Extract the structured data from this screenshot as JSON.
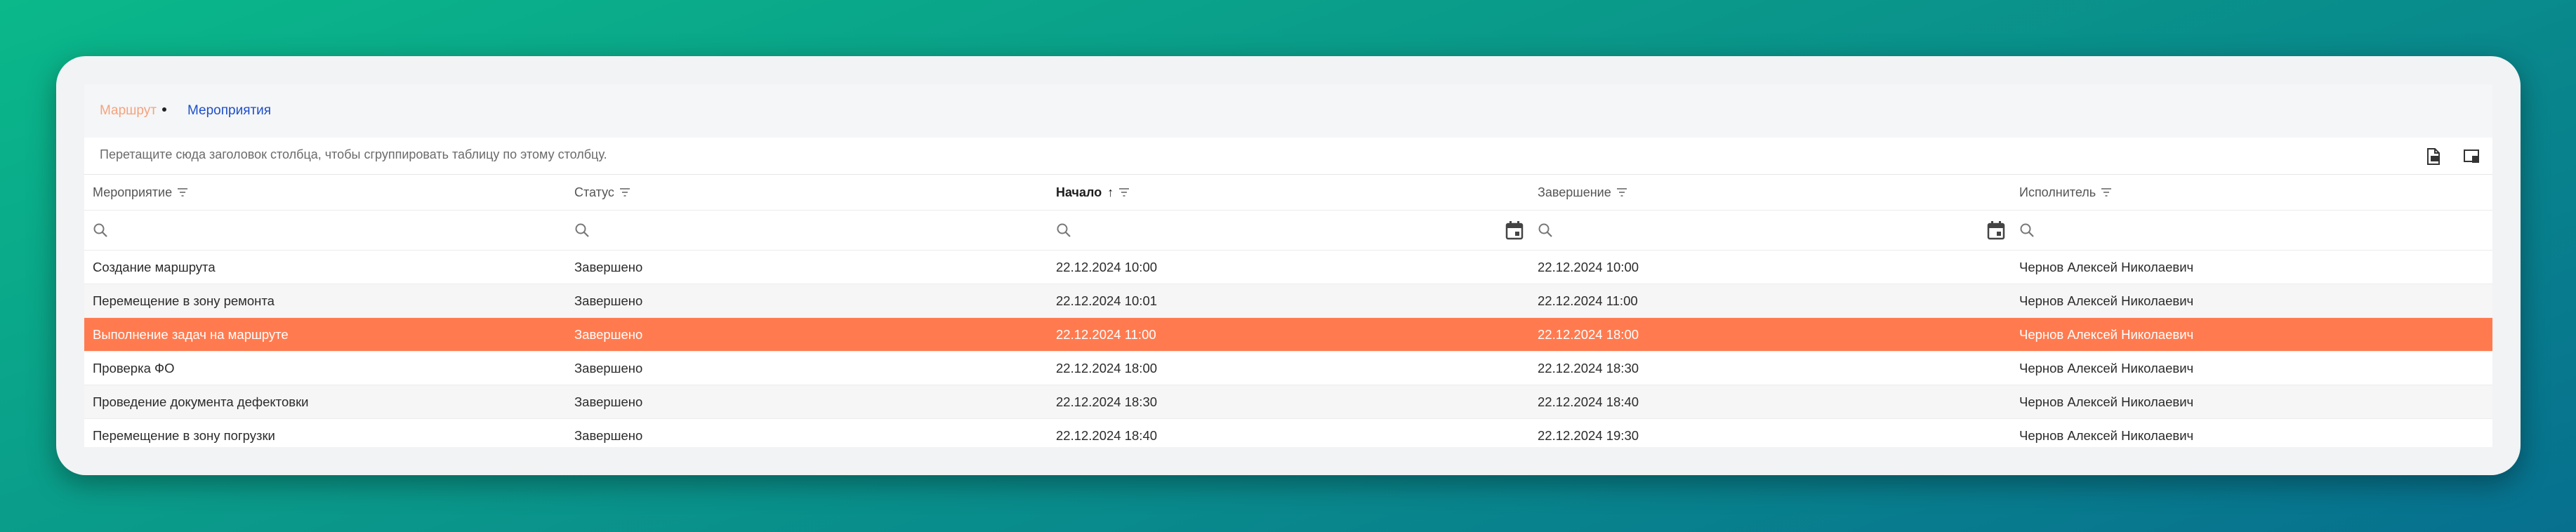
{
  "tabs": [
    {
      "label": "Маршрут",
      "active": true
    },
    {
      "label": "Мероприятия",
      "active": false
    }
  ],
  "group_panel": {
    "hint": "Перетащите сюда заголовок столбца, чтобы сгруппировать таблицу по этому столбцу."
  },
  "toolbar": {
    "export_icon": "export-document-icon",
    "column_chooser_icon": "column-chooser-icon"
  },
  "columns": [
    {
      "label": "Мероприятие",
      "sorted": false
    },
    {
      "label": "Статус",
      "sorted": false
    },
    {
      "label": "Начало",
      "sorted": true,
      "sort_direction": "asc"
    },
    {
      "label": "Завершение",
      "sorted": false
    },
    {
      "label": "Исполнитель",
      "sorted": false
    }
  ],
  "rows": [
    {
      "event": "Создание маршрута",
      "status": "Завершено",
      "start": "22.12.2024 10:00",
      "end": "22.12.2024 10:00",
      "executor": "Чернов Алексей Николаевич",
      "selected": false
    },
    {
      "event": "Перемещение в зону ремонта",
      "status": "Завершено",
      "start": "22.12.2024 10:01",
      "end": "22.12.2024 11:00",
      "executor": "Чернов Алексей Николаевич",
      "selected": false
    },
    {
      "event": "Выполнение задач на маршруте",
      "status": "Завершено",
      "start": "22.12.2024 11:00",
      "end": "22.12.2024 18:00",
      "executor": "Чернов Алексей Николаевич",
      "selected": true
    },
    {
      "event": "Проверка ФО",
      "status": "Завершено",
      "start": "22.12.2024 18:00",
      "end": "22.12.2024 18:30",
      "executor": "Чернов Алексей Николаевич",
      "selected": false
    },
    {
      "event": "Проведение документа дефектовки",
      "status": "Завершено",
      "start": "22.12.2024 18:30",
      "end": "22.12.2024 18:40",
      "executor": "Чернов Алексей Николаевич",
      "selected": false
    },
    {
      "event": "Перемещение в зону погрузки",
      "status": "Завершено",
      "start": "22.12.2024 18:40",
      "end": "22.12.2024 19:30",
      "executor": "Чернов Алексей Николаевич",
      "selected": false
    }
  ],
  "colors": {
    "accent_tab": "#f4a37e",
    "link": "#1e4fc9",
    "selected_row": "#ff7b4f"
  }
}
